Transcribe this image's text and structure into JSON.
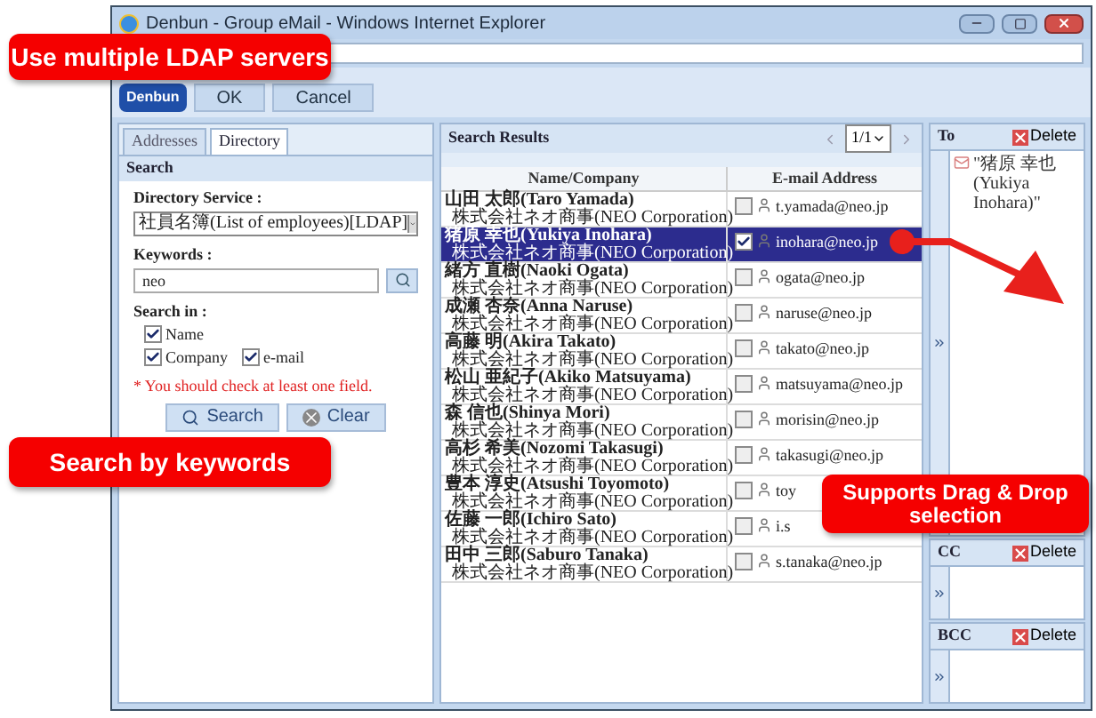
{
  "window": {
    "title": "Denbun - Group eMail - Windows Internet Explorer"
  },
  "toolbar": {
    "logo": "Denbun",
    "buttons": [
      "OK",
      "Cancel"
    ]
  },
  "left_panel": {
    "tabs": [
      {
        "label": "Addresses",
        "selected": false
      },
      {
        "label": "Directory",
        "selected": true
      }
    ],
    "section": "Search",
    "directory_service": {
      "label": "Directory Service :",
      "value": "社員名簿(List of employees)[LDAP]"
    },
    "keywords": {
      "label": "Keywords :",
      "value": "neo"
    },
    "search_in": {
      "label": "Search in :",
      "options": [
        {
          "label": "Name",
          "checked": true
        },
        {
          "label": "Company",
          "checked": true
        },
        {
          "label": "e-mail",
          "checked": true
        }
      ]
    },
    "warning": "* You should check at least one field.",
    "buttons": [
      "Search",
      "Clear"
    ]
  },
  "results": {
    "title": "Search Results",
    "page": "1/1",
    "columns": [
      "Name/Company",
      "E-mail Address"
    ],
    "rows": [
      {
        "name": "山田 太郎(Taro Yamada)",
        "company": "株式会社ネオ商事(NEO Corporation)",
        "email": "t.yamada@neo.jp",
        "selected": false,
        "checked": false
      },
      {
        "name": "猪原 幸也(Yukiya Inohara)",
        "company": "株式会社ネオ商事(NEO Corporation)",
        "email": "inohara@neo.jp",
        "selected": true,
        "checked": true
      },
      {
        "name": "緒方 直樹(Naoki Ogata)",
        "company": "株式会社ネオ商事(NEO Corporation)",
        "email": "ogata@neo.jp",
        "selected": false,
        "checked": false
      },
      {
        "name": "成瀬 杏奈(Anna Naruse)",
        "company": "株式会社ネオ商事(NEO Corporation)",
        "email": "naruse@neo.jp",
        "selected": false,
        "checked": false
      },
      {
        "name": "高藤 明(Akira Takato)",
        "company": "株式会社ネオ商事(NEO Corporation)",
        "email": "takato@neo.jp",
        "selected": false,
        "checked": false
      },
      {
        "name": "松山 亜紀子(Akiko Matsuyama)",
        "company": "株式会社ネオ商事(NEO Corporation)",
        "email": "matsuyama@neo.jp",
        "selected": false,
        "checked": false
      },
      {
        "name": "森 信也(Shinya Mori)",
        "company": "株式会社ネオ商事(NEO Corporation)",
        "email": "morisin@neo.jp",
        "selected": false,
        "checked": false
      },
      {
        "name": "高杉 希美(Nozomi Takasugi)",
        "company": "株式会社ネオ商事(NEO Corporation)",
        "email": "takasugi@neo.jp",
        "selected": false,
        "checked": false
      },
      {
        "name": "豊本 淳史(Atsushi Toyomoto)",
        "company": "株式会社ネオ商事(NEO Corporation)",
        "email": "toy",
        "selected": false,
        "checked": false
      },
      {
        "name": "佐藤 一郎(Ichiro Sato)",
        "company": "株式会社ネオ商事(NEO Corporation)",
        "email": "i.s",
        "selected": false,
        "checked": false
      },
      {
        "name": "田中 三郎(Saburo Tanaka)",
        "company": "株式会社ネオ商事(NEO Corporation)",
        "email": "s.tanaka@neo.jp",
        "selected": false,
        "checked": false
      }
    ]
  },
  "recipients": [
    {
      "label": "To",
      "delete": "Delete",
      "items": [
        "\"猪原 幸也(Yukiya Inohara)\""
      ]
    },
    {
      "label": "CC",
      "delete": "Delete"
    },
    {
      "label": "BCC",
      "delete": "Delete"
    }
  ],
  "callouts": [
    "Use multiple LDAP servers",
    "Search by keywords",
    "Supports Drag & Drop selection"
  ]
}
